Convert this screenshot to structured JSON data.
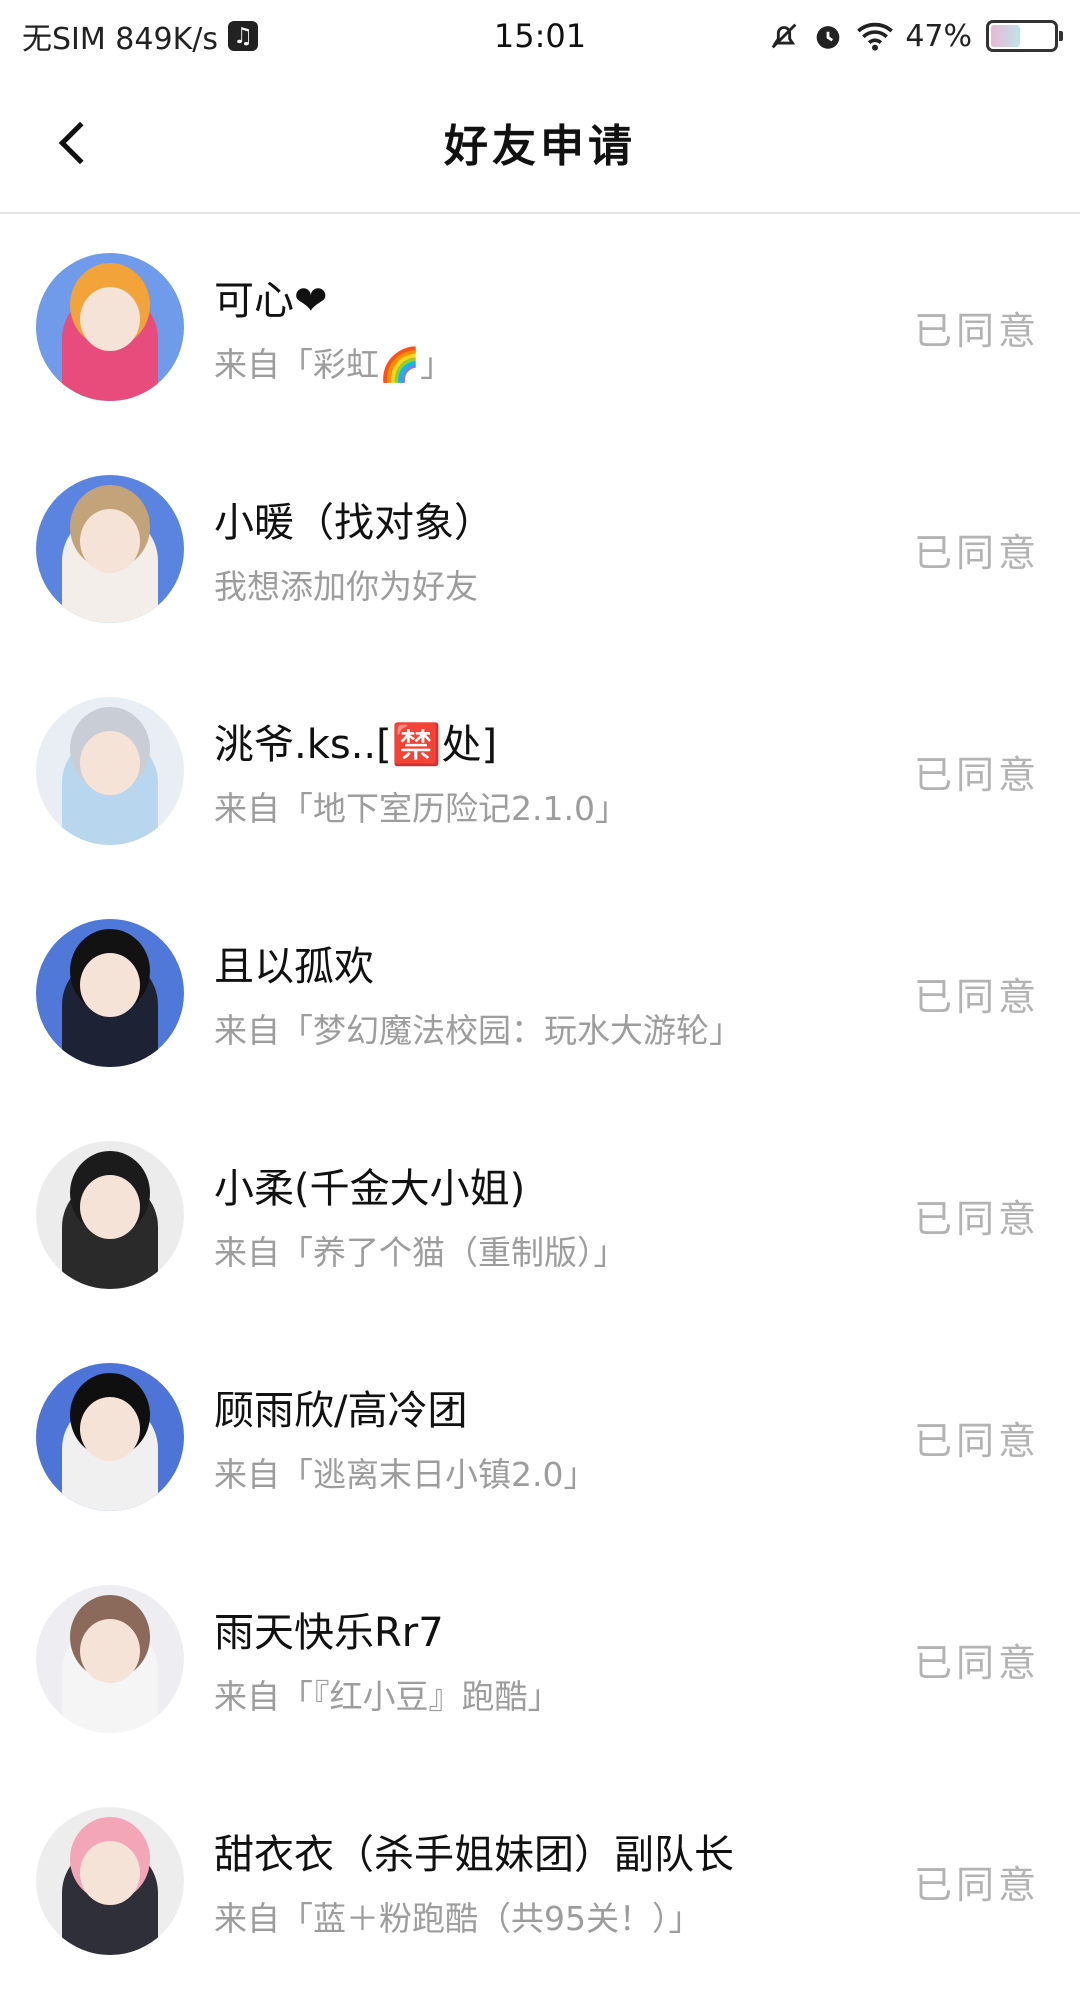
{
  "status_bar": {
    "carrier": "无SIM 849K/s",
    "time": "15:01",
    "battery": "47%",
    "battery_level": 0.47,
    "icons": [
      "music-icon",
      "bell-off-icon",
      "alarm-icon",
      "wifi-icon",
      "battery-icon"
    ]
  },
  "header": {
    "title": "好友申请",
    "back_icon": "chevron-left-icon"
  },
  "requests": [
    {
      "name": "可心❤",
      "source": "来自「彩虹🌈」",
      "status": "已同意",
      "bg": "#6f9bea",
      "hair": "#f2a33a",
      "outfit": "#e84c7c"
    },
    {
      "name": "小暖（找对象）",
      "source": "我想添加你为好友",
      "status": "已同意",
      "bg": "#5b84e0",
      "hair": "#c2a37a",
      "outfit": "#f3eee9"
    },
    {
      "name": "洮爷.ks..[🈲处]",
      "source": "来自「地下室历险记2.1.0」",
      "status": "已同意",
      "bg": "#e9eef4",
      "hair": "#c9ced6",
      "outfit": "#b8d6ee"
    },
    {
      "name": "且以孤欢",
      "source": "来自「梦幻魔法校园：玩水大游轮」",
      "status": "已同意",
      "bg": "#4f78d8",
      "hair": "#121212",
      "outfit": "#1e2235"
    },
    {
      "name": "小柔(千金大小姐)",
      "source": "来自「养了个猫（重制版）」",
      "status": "已同意",
      "bg": "#ececec",
      "hair": "#1b1b1b",
      "outfit": "#2a2a2a"
    },
    {
      "name": "顾雨欣/高冷团",
      "source": "来自「逃离末日小镇2.0」",
      "status": "已同意",
      "bg": "#4d74d6",
      "hair": "#0f0f0f",
      "outfit": "#f0f0f0"
    },
    {
      "name": "雨天快乐Rr7",
      "source": "来自「『红小豆』跑酷」",
      "status": "已同意",
      "bg": "#eeeef2",
      "hair": "#8b6a5c",
      "outfit": "#f5f5f5"
    },
    {
      "name": "甜衣衣（杀手姐妹团）副队长",
      "source": "来自「蓝＋粉跑酷（共95关！）」",
      "status": "已同意",
      "bg": "#ededed",
      "hair": "#f3a6b8",
      "outfit": "#2f2f3a"
    }
  ]
}
